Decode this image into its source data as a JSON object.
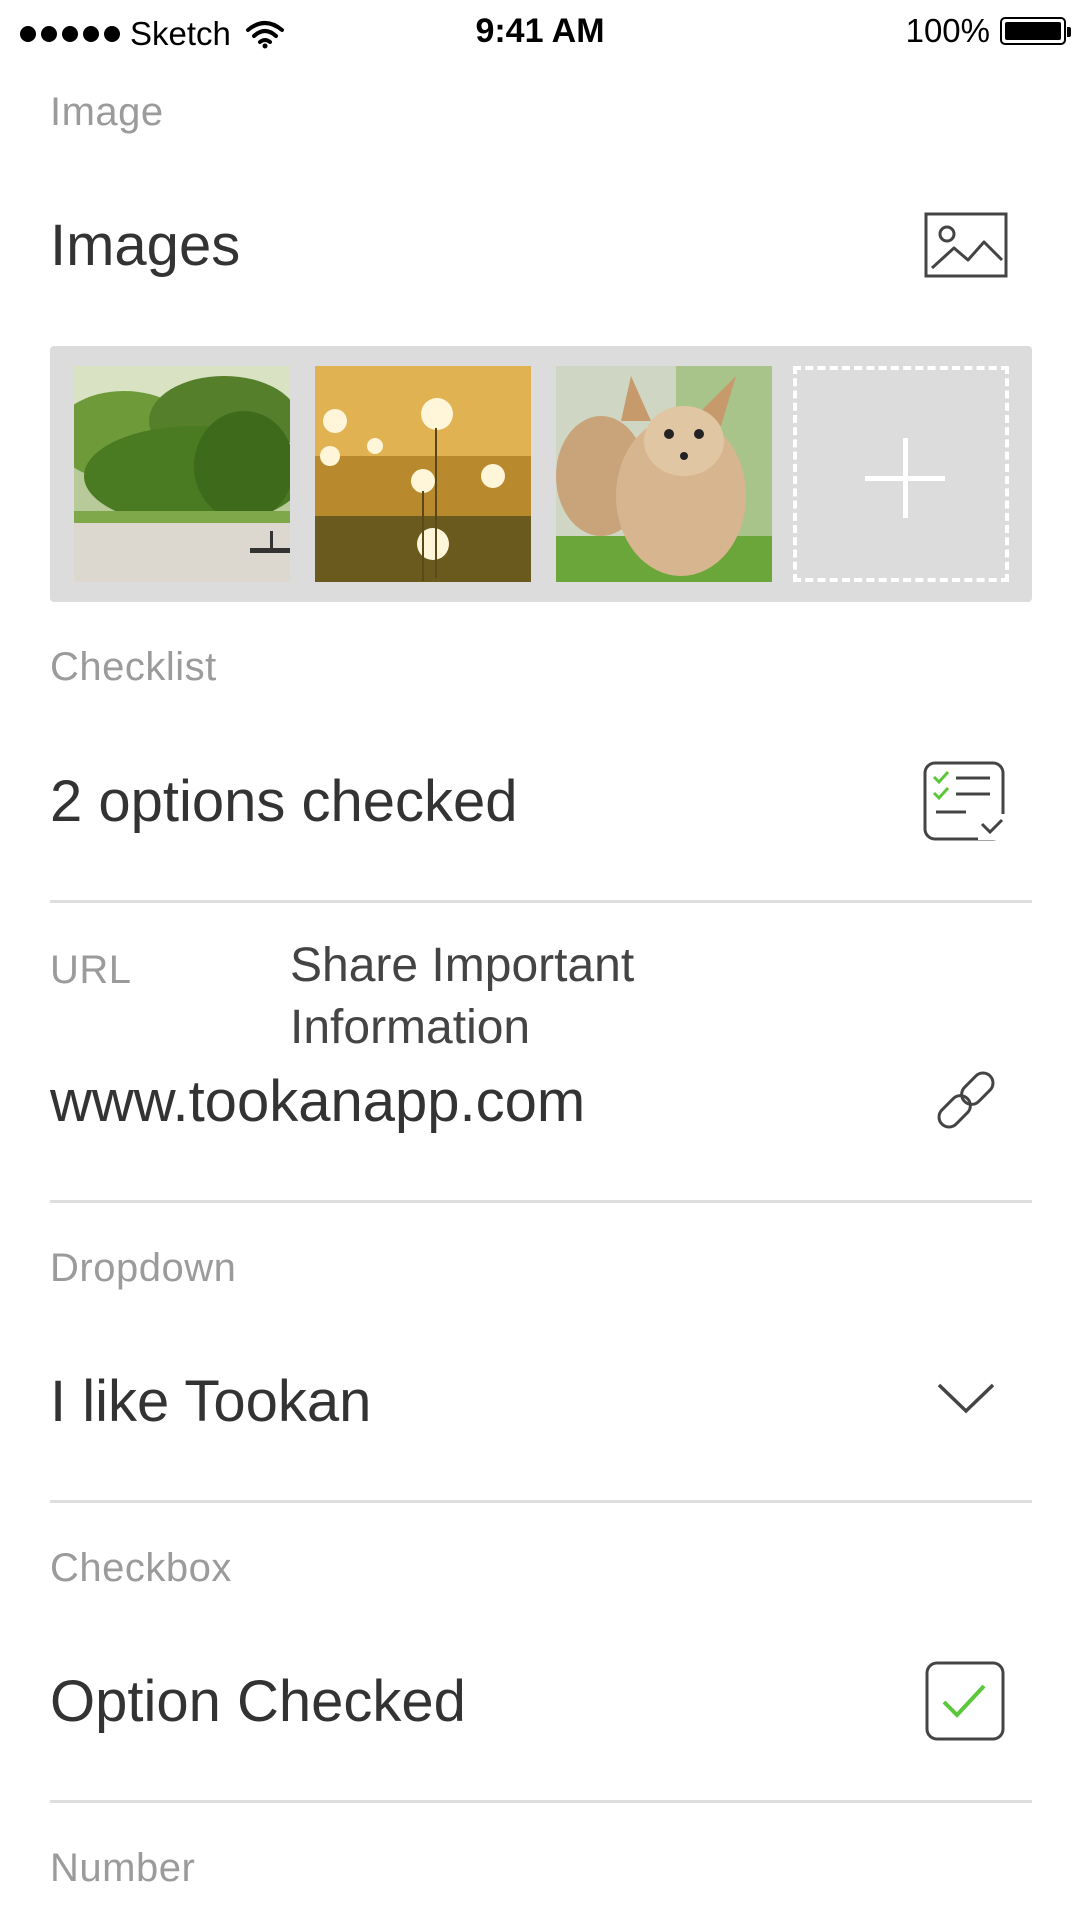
{
  "status_bar": {
    "carrier": "Sketch",
    "time": "9:41 AM",
    "battery": "100%"
  },
  "image_section": {
    "label": "Image",
    "value": "Images",
    "icon": "image-icon",
    "thumbnails": [
      "forest-river-photo",
      "dandelions-photo",
      "fox-kits-photo"
    ],
    "add_icon": "plus-icon"
  },
  "checklist_section": {
    "label": "Checklist",
    "value": "2 options checked",
    "icon": "checklist-icon",
    "accent_color": "#5ac83a"
  },
  "url_section": {
    "label": "URL",
    "share_text": "Share Important Information",
    "value": "www.tookanapp.com",
    "icon": "link-icon"
  },
  "dropdown_section": {
    "label": "Dropdown",
    "value": "I like Tookan",
    "icon": "chevron-down-icon"
  },
  "checkbox_section": {
    "label": "Checkbox",
    "value": "Option Checked",
    "checked": true,
    "icon": "checkbox-checked-icon"
  },
  "number_section": {
    "label": "Number"
  }
}
